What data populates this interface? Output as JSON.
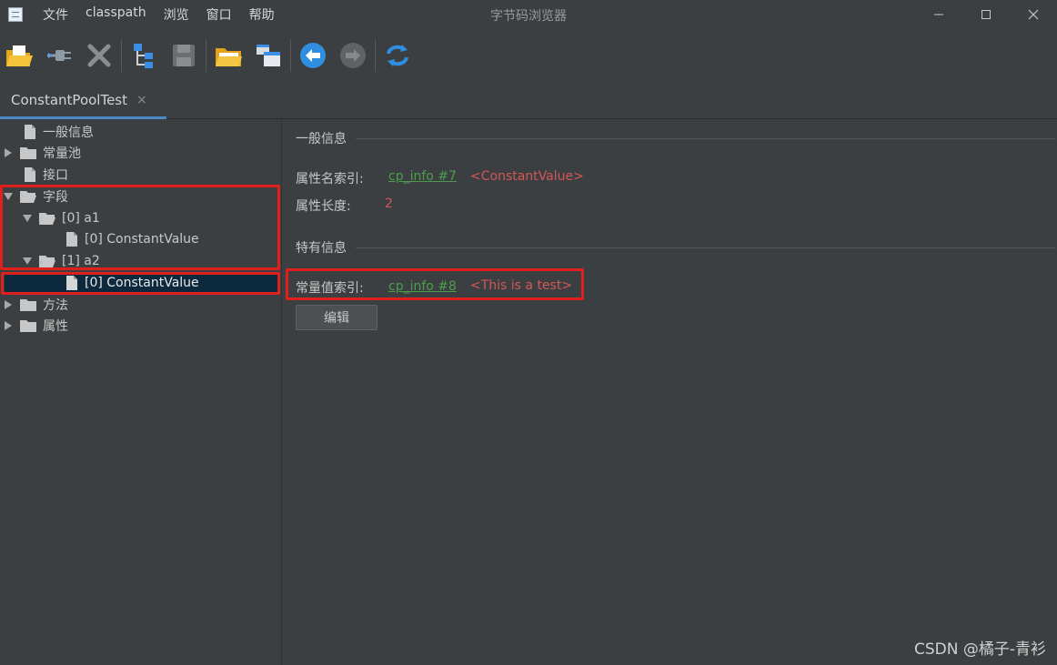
{
  "menu": {
    "items": [
      "文件",
      "classpath",
      "浏览",
      "窗口",
      "帮助"
    ]
  },
  "window": {
    "title": "字节码浏览器"
  },
  "toolbar": {
    "buttons": [
      "open-file-icon",
      "plug-icon",
      "close-x-icon",
      "tree-icon",
      "save-icon",
      "open-folder-icon",
      "window-icon",
      "back-icon",
      "forward-icon",
      "refresh-icon"
    ]
  },
  "tab": {
    "label": "ConstantPoolTest",
    "close": "×"
  },
  "tree": {
    "general": "一般信息",
    "constant_pool": "常量池",
    "interfaces": "接口",
    "fields": "字段",
    "field0": "[0] a1",
    "field0_attr": "[0] ConstantValue",
    "field1": "[1] a2",
    "field1_attr": "[0] ConstantValue",
    "methods": "方法",
    "attributes": "属性"
  },
  "panel": {
    "general_title": "一般信息",
    "name_index_label": "属性名索引:",
    "name_index_link": "cp_info #7",
    "name_index_value": "<ConstantValue>",
    "length_label": "属性长度:",
    "length_value": "2",
    "specific_title": "特有信息",
    "const_index_label": "常量值索引:",
    "const_index_link": "cp_info #8",
    "const_index_value": "<This is a test>",
    "edit_button": "编辑"
  },
  "watermark": "CSDN @橘子-青衫",
  "colors": {
    "selection": "#0d293e",
    "link": "#4d9c4d",
    "value_red": "#d35757",
    "annotation": "#e0201c",
    "accent_tab": "#4a88c7"
  }
}
